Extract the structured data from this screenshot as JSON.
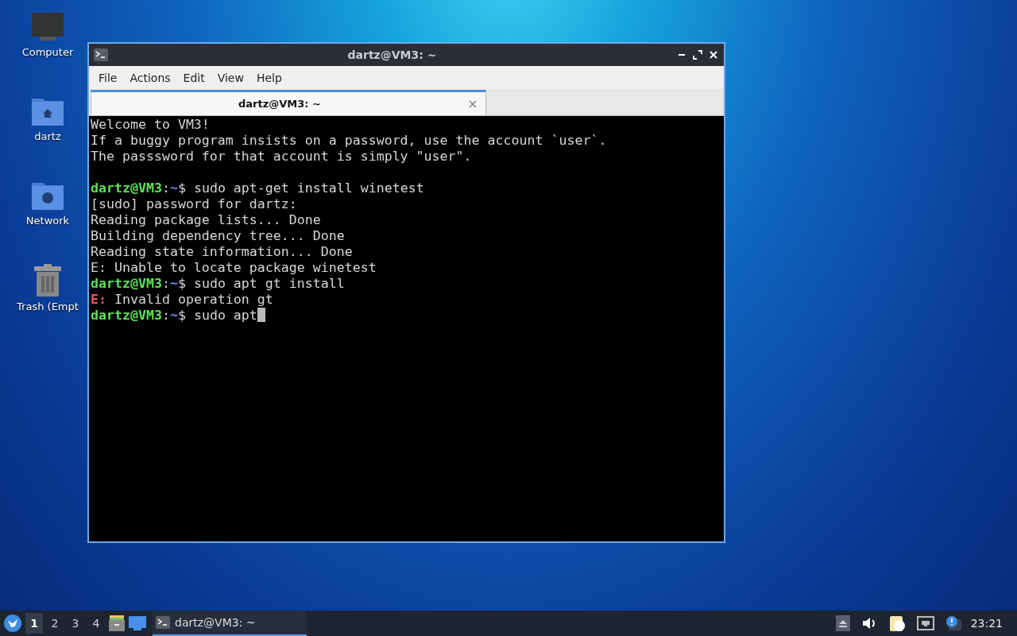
{
  "desktop_icons": [
    {
      "kind": "computer",
      "label": "Computer"
    },
    {
      "kind": "home",
      "label": "dartz"
    },
    {
      "kind": "network",
      "label": "Network"
    },
    {
      "kind": "trash",
      "label": "Trash (Empt"
    }
  ],
  "window": {
    "title": "dartz@VM3: ~",
    "menu": [
      "File",
      "Actions",
      "Edit",
      "View",
      "Help"
    ],
    "tabs": [
      {
        "label": "dartz@VM3: ~",
        "selected": true
      }
    ],
    "terminal": [
      {
        "kind": "text",
        "text": "Welcome to VM3!"
      },
      {
        "kind": "text",
        "text": "If a buggy program insists on a password, use the account `user`."
      },
      {
        "kind": "text",
        "text": "The passsword for that account is simply \"user\"."
      },
      {
        "kind": "blank"
      },
      {
        "kind": "prompt",
        "host": "dartz@VM3",
        "sep": ":",
        "path": "~",
        "sign": "$",
        "command": "sudo apt-get install winetest",
        "cursor": false
      },
      {
        "kind": "text",
        "text": "[sudo] password for dartz:"
      },
      {
        "kind": "text",
        "text": "Reading package lists... Done"
      },
      {
        "kind": "text",
        "text": "Building dependency tree... Done"
      },
      {
        "kind": "text",
        "text": "Reading state information... Done"
      },
      {
        "kind": "text",
        "text": "E: Unable to locate package winetest"
      },
      {
        "kind": "prompt",
        "host": "dartz@VM3",
        "sep": ":",
        "path": "~",
        "sign": "$",
        "command": "sudo apt gt install",
        "cursor": false
      },
      {
        "kind": "error",
        "tag": "E:",
        "text": "Invalid operation gt"
      },
      {
        "kind": "prompt",
        "host": "dartz@VM3",
        "sep": ":",
        "path": "~",
        "sign": "$",
        "command": "sudo apt",
        "cursor": true
      }
    ]
  },
  "taskbar": {
    "workspaces": [
      {
        "label": "1",
        "selected": true
      },
      {
        "label": "2",
        "selected": false
      },
      {
        "label": "3",
        "selected": false
      },
      {
        "label": "4",
        "selected": false
      }
    ],
    "tasks": [
      {
        "label": "dartz@VM3: ~",
        "selected": true
      }
    ],
    "clock": "23:21"
  }
}
